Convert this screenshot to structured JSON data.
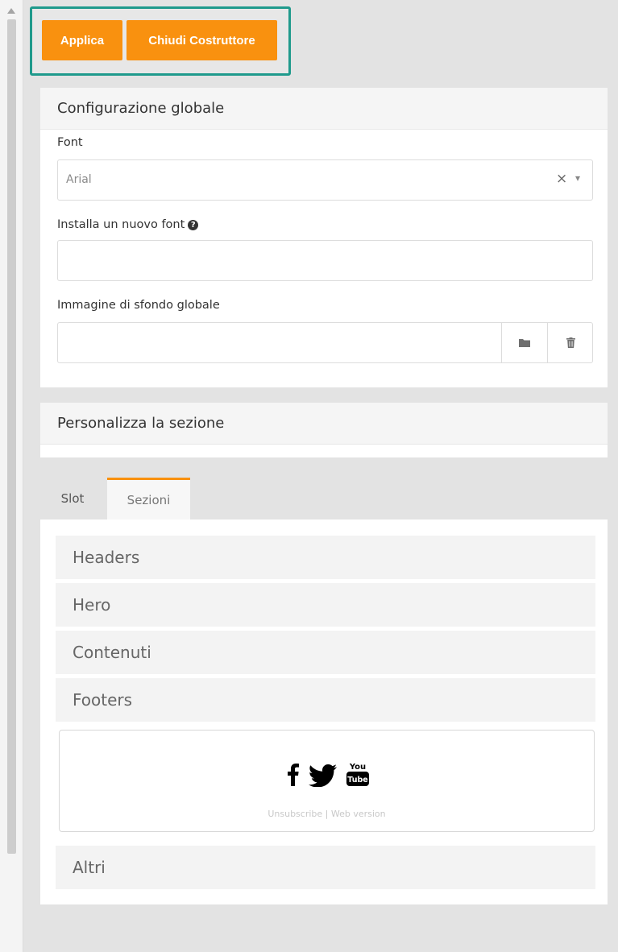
{
  "toolbar": {
    "apply_label": "Applica",
    "close_builder_label": "Chiudi Costruttore",
    "accent_color": "#f9910f",
    "highlight_color": "#1f9a8c"
  },
  "global_config": {
    "title": "Configurazione globale",
    "font_label": "Font",
    "font_value": "Arial",
    "clear_symbol": "×",
    "dropdown_symbol": "▾",
    "install_font_label": "Installa un nuovo font",
    "install_font_value": "",
    "bg_image_label": "Immagine di sfondo globale",
    "bg_image_value": ""
  },
  "customize_section": {
    "title": "Personalizza la sezione"
  },
  "tabs": [
    {
      "label": "Slot",
      "active": false
    },
    {
      "label": "Sezioni",
      "active": true
    }
  ],
  "sections": {
    "items": [
      "Headers",
      "Hero",
      "Contenuti",
      "Footers",
      "Altri"
    ],
    "footer_preview": {
      "links_text": "Unsubscribe | Web version",
      "social_icons": [
        "facebook-icon",
        "twitter-icon",
        "youtube-icon"
      ]
    }
  }
}
